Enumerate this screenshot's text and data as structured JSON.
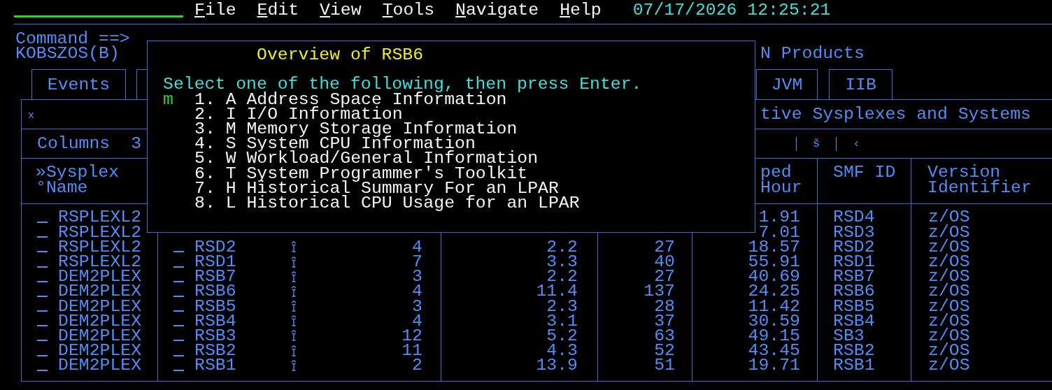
{
  "menu": [
    "File",
    "Edit",
    "View",
    "Tools",
    "Navigate",
    "Help"
  ],
  "datetime": "07/17/2026 12:25:21",
  "command_label": "Command ==>",
  "workspace_id": "KOBSZOS(B)",
  "workspace_title": "N Products",
  "tabs_left": [
    {
      "label": "Events"
    }
  ],
  "tabs_right": [
    {
      "label": "JVM"
    },
    {
      "label": "IIB"
    }
  ],
  "panel": {
    "close": "x",
    "title": "tive Sysplexes and Systems",
    "columns_label": "Columns",
    "columns_value": "3",
    "toolbar_glyphs": [
      "š",
      "‹"
    ]
  },
  "table": {
    "headers": {
      "sysplex_name": [
        "»Sysplex",
        "°Name"
      ],
      "column_6": [
        "ped",
        "Hour"
      ],
      "smf_id": [
        "SMF ID"
      ],
      "version": [
        "Version",
        "Identifier"
      ]
    },
    "rows": [
      {
        "sysplex_name": "RSPLEXL2",
        "column_6": "1.91",
        "smf_id": "RSD4",
        "version": "z/OS"
      },
      {
        "sysplex_name": "RSPLEXL2",
        "column_6": "7.01",
        "smf_id": "RSD3",
        "version": "z/OS"
      },
      {
        "sysplex_name": "RSPLEXL2",
        "system_name": "RSD2",
        "column_3": "4",
        "column_4": "2.2",
        "column_5": "27",
        "column_6": "18.57",
        "smf_id": "RSD2",
        "version": "z/OS"
      },
      {
        "sysplex_name": "RSPLEXL2",
        "system_name": "RSD1",
        "column_3": "7",
        "column_4": "3.3",
        "column_5": "40",
        "column_6": "55.91",
        "smf_id": "RSD1",
        "version": "z/OS"
      },
      {
        "sysplex_name": "DEM2PLEX",
        "system_name": "RSB7",
        "column_3": "3",
        "column_4": "2.2",
        "column_5": "27",
        "column_6": "40.69",
        "smf_id": "RSB7",
        "version": "z/OS"
      },
      {
        "sysplex_name": "DEM2PLEX",
        "system_name": "RSB6",
        "column_3": "4",
        "column_4": "11.4",
        "column_5": "137",
        "column_6": "24.25",
        "smf_id": "RSB6",
        "version": "z/OS"
      },
      {
        "sysplex_name": "DEM2PLEX",
        "system_name": "RSB5",
        "column_3": "3",
        "column_4": "2.3",
        "column_5": "28",
        "column_6": "11.42",
        "smf_id": "RSB5",
        "version": "z/OS"
      },
      {
        "sysplex_name": "DEM2PLEX",
        "system_name": "RSB4",
        "column_3": "4",
        "column_4": "3.1",
        "column_5": "37",
        "column_6": "30.59",
        "smf_id": "RSB4",
        "version": "z/OS"
      },
      {
        "sysplex_name": "DEM2PLEX",
        "system_name": "RSB3",
        "column_3": "12",
        "column_4": "5.2",
        "column_5": "63",
        "column_6": "49.15",
        "smf_id": "SB3",
        "version": "z/OS"
      },
      {
        "sysplex_name": "DEM2PLEX",
        "system_name": "RSB2",
        "column_3": "11",
        "column_4": "4.3",
        "column_5": "52",
        "column_6": "43.45",
        "smf_id": "RSB2",
        "version": "z/OS"
      },
      {
        "sysplex_name": "DEM2PLEX",
        "system_name": "RSB1",
        "column_3": "2",
        "column_4": "13.9",
        "column_5": "51",
        "column_6": "19.71",
        "smf_id": "RSB1",
        "version": "z/OS"
      }
    ]
  },
  "popup": {
    "title": "Overview of RSB6",
    "instruction": "Select one of the following, then press Enter.",
    "selection": "m",
    "options": [
      "1. A Address Space Information",
      "2. I I/O Information",
      "3. M Memory Storage Information",
      "4. S System CPU Information",
      "5. W Workload/General Information",
      "6. T System Programmer's Toolkit",
      "7. H Historical Summary For an LPAR",
      "8. L Historical CPU Usage for an LPAR"
    ]
  }
}
